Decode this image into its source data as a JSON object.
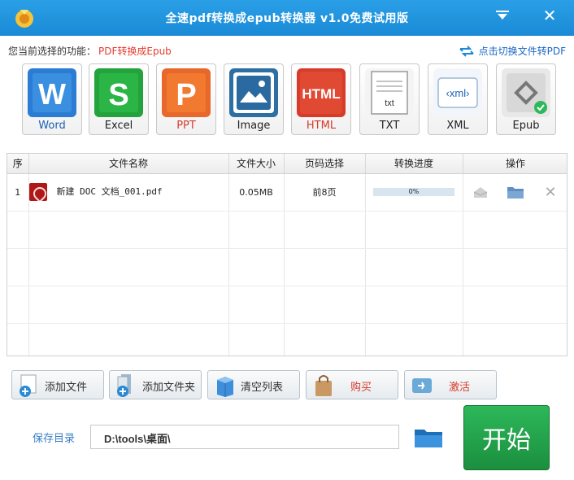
{
  "window": {
    "title": "全速pdf转换成epub转换器 v1.0免费试用版"
  },
  "function_row": {
    "label": "您当前选择的功能：",
    "value": "PDF转换成Epub",
    "switch_link": "点击切换文件转PDF"
  },
  "formats": [
    {
      "label": "Word",
      "icon": "word-icon",
      "color": "#2b7dd4"
    },
    {
      "label": "Excel",
      "icon": "excel-icon",
      "color": "#24a33c"
    },
    {
      "label": "PPT",
      "icon": "ppt-icon",
      "color": "#e8672a"
    },
    {
      "label": "Image",
      "icon": "image-icon",
      "color": "#2c6fa3"
    },
    {
      "label": "HTML",
      "icon": "html-icon",
      "color": "#d63b2b"
    },
    {
      "label": "TXT",
      "icon": "txt-icon",
      "color": "#777777"
    },
    {
      "label": "XML",
      "icon": "xml-icon",
      "color": "#1a5fb8"
    },
    {
      "label": "Epub",
      "icon": "epub-icon",
      "color": "#555555"
    }
  ],
  "table": {
    "headers": [
      "序",
      "文件名称",
      "文件大小",
      "页码选择",
      "转换进度",
      "操作"
    ],
    "rows": [
      {
        "index": "1",
        "name": "新建 DOC 文档_001.pdf",
        "size": "0.05MB",
        "pages": "前8页",
        "progress_text": "0%",
        "progress": 0
      }
    ]
  },
  "actions": {
    "add_file": "添加文件",
    "add_folder": "添加文件夹",
    "clear_list": "清空列表",
    "buy": "购买",
    "activate": "激活"
  },
  "save": {
    "label": "保存目录",
    "path": "D:\\tools\\桌面\\"
  },
  "start_button": "开始",
  "colors": {
    "titlebar": "#1a8ad6",
    "accent_red": "#d63b2b",
    "start_green": "#1b8f3e"
  }
}
